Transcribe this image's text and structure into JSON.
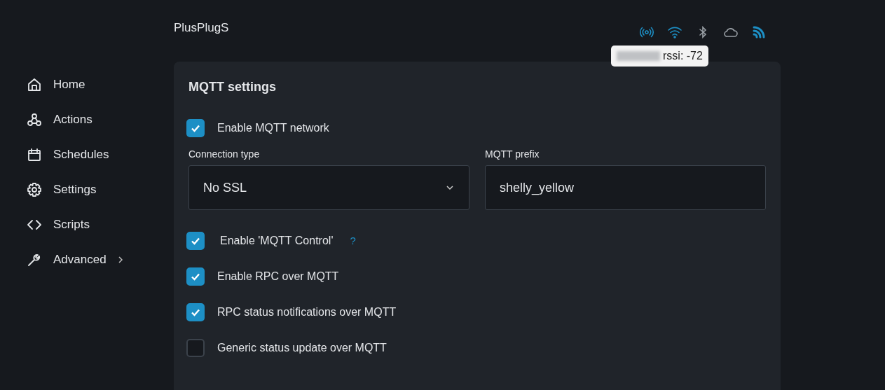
{
  "header": {
    "title": "PlusPlugS",
    "status_icons": [
      {
        "kind": "radio",
        "active": true
      },
      {
        "kind": "wifi",
        "active": true
      },
      {
        "kind": "bluetooth",
        "active": false
      },
      {
        "kind": "cloud",
        "active": false
      },
      {
        "kind": "mqtt",
        "active": true
      }
    ],
    "tooltip": {
      "text": "rssi: -72"
    }
  },
  "sidebar": {
    "items": [
      {
        "label": "Home",
        "expandable": false
      },
      {
        "label": "Actions",
        "expandable": false
      },
      {
        "label": "Schedules",
        "expandable": false
      },
      {
        "label": "Settings",
        "expandable": false
      },
      {
        "label": "Scripts",
        "expandable": false
      },
      {
        "label": "Advanced",
        "expandable": true
      }
    ]
  },
  "card": {
    "title": "MQTT settings",
    "enable": {
      "label": "Enable MQTT network",
      "checked": true
    },
    "fields": [
      {
        "kind": "select",
        "label": "Connection type",
        "value": "No SSL"
      },
      {
        "kind": "text",
        "label": "MQTT prefix",
        "value": "shelly_yellow"
      }
    ],
    "options": [
      {
        "label": "Enable 'MQTT Control'",
        "help": "?",
        "checked": true
      },
      {
        "label": "Enable RPC over MQTT",
        "checked": true
      },
      {
        "label": "RPC status notifications over MQTT",
        "checked": true
      },
      {
        "label": "Generic status update over MQTT",
        "checked": false
      }
    ]
  }
}
